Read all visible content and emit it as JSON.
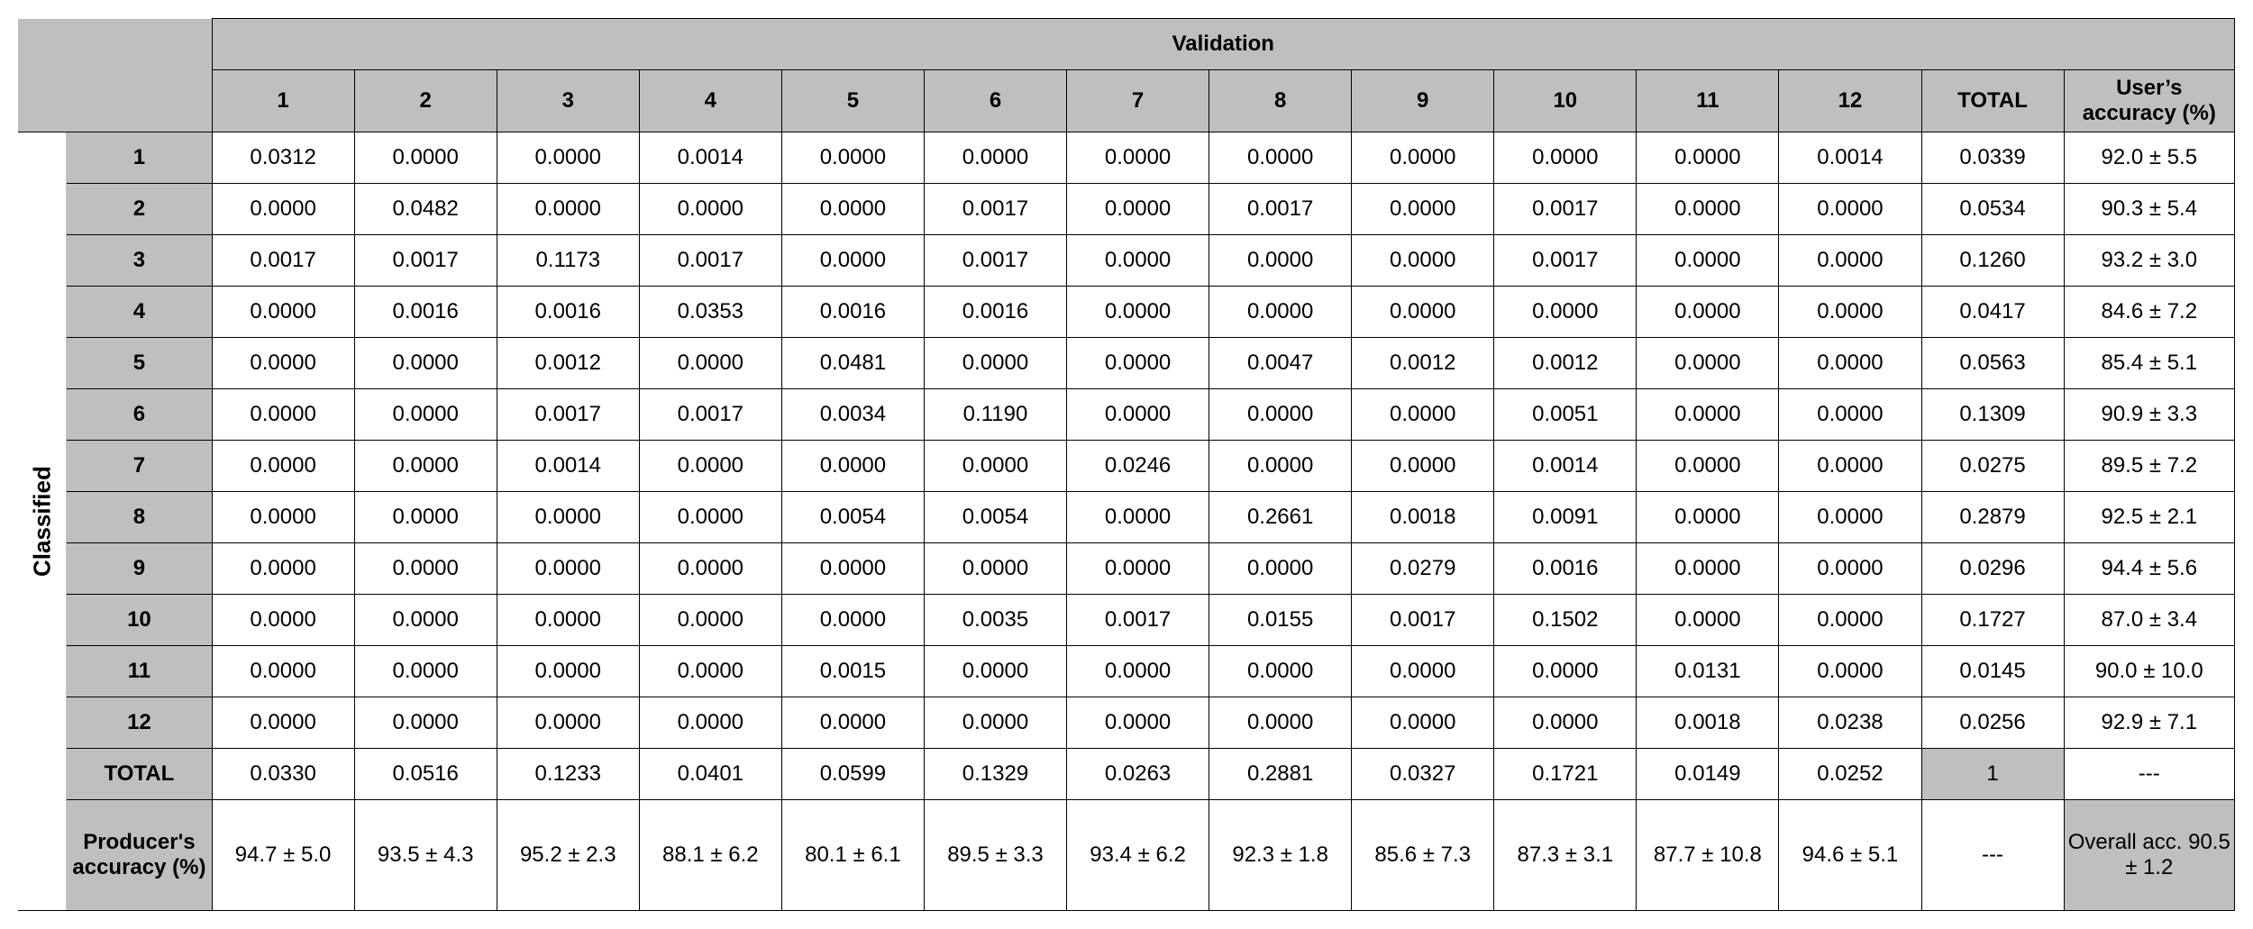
{
  "chart_data": {
    "type": "table",
    "title_rows": "Classified",
    "title_cols": "Validation",
    "col_labels": [
      "1",
      "2",
      "3",
      "4",
      "5",
      "6",
      "7",
      "8",
      "9",
      "10",
      "11",
      "12",
      "TOTAL",
      "User’s accuracy (%)"
    ],
    "row_labels": [
      "1",
      "2",
      "3",
      "4",
      "5",
      "6",
      "7",
      "8",
      "9",
      "10",
      "11",
      "12",
      "TOTAL",
      "Producer's accuracy (%)"
    ],
    "matrix": [
      [
        "0.0312",
        "0.0000",
        "0.0000",
        "0.0014",
        "0.0000",
        "0.0000",
        "0.0000",
        "0.0000",
        "0.0000",
        "0.0000",
        "0.0000",
        "0.0014",
        "0.0339",
        "92.0 ± 5.5"
      ],
      [
        "0.0000",
        "0.0482",
        "0.0000",
        "0.0000",
        "0.0000",
        "0.0017",
        "0.0000",
        "0.0017",
        "0.0000",
        "0.0017",
        "0.0000",
        "0.0000",
        "0.0534",
        "90.3 ± 5.4"
      ],
      [
        "0.0017",
        "0.0017",
        "0.1173",
        "0.0017",
        "0.0000",
        "0.0017",
        "0.0000",
        "0.0000",
        "0.0000",
        "0.0017",
        "0.0000",
        "0.0000",
        "0.1260",
        "93.2 ± 3.0"
      ],
      [
        "0.0000",
        "0.0016",
        "0.0016",
        "0.0353",
        "0.0016",
        "0.0016",
        "0.0000",
        "0.0000",
        "0.0000",
        "0.0000",
        "0.0000",
        "0.0000",
        "0.0417",
        "84.6 ± 7.2"
      ],
      [
        "0.0000",
        "0.0000",
        "0.0012",
        "0.0000",
        "0.0481",
        "0.0000",
        "0.0000",
        "0.0047",
        "0.0012",
        "0.0012",
        "0.0000",
        "0.0000",
        "0.0563",
        "85.4 ± 5.1"
      ],
      [
        "0.0000",
        "0.0000",
        "0.0017",
        "0.0017",
        "0.0034",
        "0.1190",
        "0.0000",
        "0.0000",
        "0.0000",
        "0.0051",
        "0.0000",
        "0.0000",
        "0.1309",
        "90.9 ± 3.3"
      ],
      [
        "0.0000",
        "0.0000",
        "0.0014",
        "0.0000",
        "0.0000",
        "0.0000",
        "0.0246",
        "0.0000",
        "0.0000",
        "0.0014",
        "0.0000",
        "0.0000",
        "0.0275",
        "89.5 ± 7.2"
      ],
      [
        "0.0000",
        "0.0000",
        "0.0000",
        "0.0000",
        "0.0054",
        "0.0054",
        "0.0000",
        "0.2661",
        "0.0018",
        "0.0091",
        "0.0000",
        "0.0000",
        "0.2879",
        "92.5 ± 2.1"
      ],
      [
        "0.0000",
        "0.0000",
        "0.0000",
        "0.0000",
        "0.0000",
        "0.0000",
        "0.0000",
        "0.0000",
        "0.0279",
        "0.0016",
        "0.0000",
        "0.0000",
        "0.0296",
        "94.4 ± 5.6"
      ],
      [
        "0.0000",
        "0.0000",
        "0.0000",
        "0.0000",
        "0.0000",
        "0.0035",
        "0.0017",
        "0.0155",
        "0.0017",
        "0.1502",
        "0.0000",
        "0.0000",
        "0.1727",
        "87.0 ± 3.4"
      ],
      [
        "0.0000",
        "0.0000",
        "0.0000",
        "0.0000",
        "0.0015",
        "0.0000",
        "0.0000",
        "0.0000",
        "0.0000",
        "0.0000",
        "0.0131",
        "0.0000",
        "0.0145",
        "90.0 ± 10.0"
      ],
      [
        "0.0000",
        "0.0000",
        "0.0000",
        "0.0000",
        "0.0000",
        "0.0000",
        "0.0000",
        "0.0000",
        "0.0000",
        "0.0000",
        "0.0018",
        "0.0238",
        "0.0256",
        "92.9 ± 7.1"
      ],
      [
        "0.0330",
        "0.0516",
        "0.1233",
        "0.0401",
        "0.0599",
        "0.1329",
        "0.0263",
        "0.2881",
        "0.0327",
        "0.1721",
        "0.0149",
        "0.0252",
        "1",
        "---"
      ],
      [
        "94.7 ± 5.0",
        "93.5 ± 4.3",
        "95.2 ± 2.3",
        "88.1 ± 6.2",
        "80.1 ± 6.1",
        "89.5 ± 3.3",
        "93.4 ± 6.2",
        "92.3 ± 1.8",
        "85.6 ± 7.3",
        "87.3 ± 3.1",
        "87.7 ± 10.8",
        "94.6 ± 5.1",
        "---",
        "Overall acc. 90.5 ± 1.2"
      ]
    ]
  }
}
